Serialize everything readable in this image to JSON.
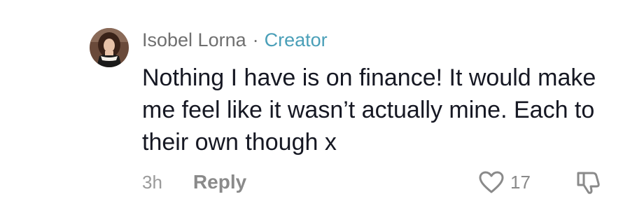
{
  "comment": {
    "author": "Isobel Lorna",
    "separator": "·",
    "author_badge": "Creator",
    "text": "Nothing I have is on finance! It would make me feel like it wasn’t actually mine. Each to their own though x",
    "timestamp": "3h",
    "reply_label": "Reply",
    "like_count": "17",
    "icons": {
      "like": "heart-outline-icon",
      "dislike": "thumbs-down-outline-icon"
    }
  },
  "colors": {
    "author": "#6f6f6f",
    "badge": "#4a9fb8",
    "text": "#161823",
    "muted": "#8a8a8a"
  }
}
